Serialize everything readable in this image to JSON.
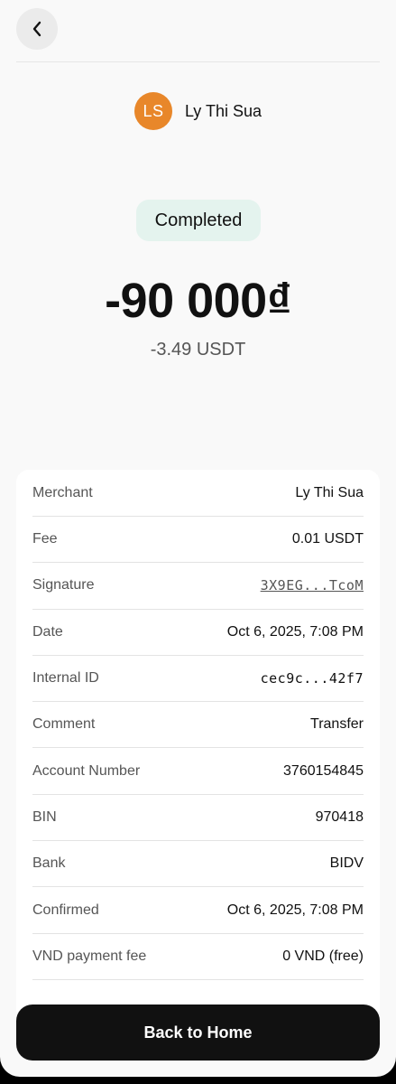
{
  "header": {
    "back_icon": "chevron-left-icon"
  },
  "user": {
    "initials": "LS",
    "name": "Ly Thi Sua",
    "avatar_color": "#e8872a"
  },
  "status": {
    "label": "Completed",
    "badge_color": "#e4f3ee"
  },
  "amount": {
    "primary": "-90 000₫",
    "secondary": "-3.49 USDT"
  },
  "details": {
    "rows": [
      {
        "label": "Merchant",
        "value": "Ly Thi Sua"
      },
      {
        "label": "Fee",
        "value": "0.01 USDT"
      },
      {
        "label": "Signature",
        "value": "3X9EG...TcoM"
      },
      {
        "label": "Date",
        "value": "Oct 6, 2025, 7:08 PM"
      },
      {
        "label": "Internal ID",
        "value": "cec9c...42f7"
      },
      {
        "label": "Comment",
        "value": "Transfer"
      },
      {
        "label": "Account Number",
        "value": "3760154845"
      },
      {
        "label": "BIN",
        "value": "970418"
      },
      {
        "label": "Bank",
        "value": "BIDV"
      },
      {
        "label": "Confirmed",
        "value": "Oct 6, 2025, 7:08 PM"
      },
      {
        "label": "VND payment fee",
        "value": "0 VND (free)"
      }
    ]
  },
  "footer": {
    "home_button_label": "Back to Home"
  }
}
